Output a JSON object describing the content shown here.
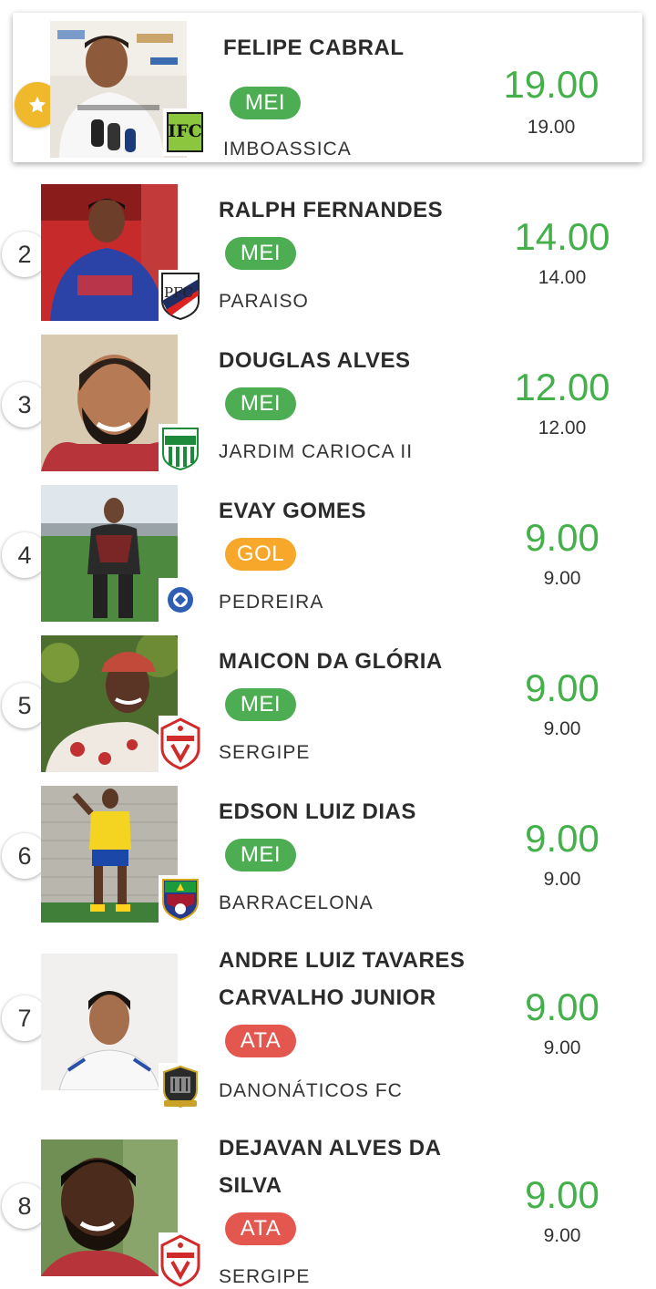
{
  "colors": {
    "score_green": "#43b04a",
    "badge_mei": "#4cad52",
    "badge_gol": "#f7a82a",
    "badge_ata": "#e4574f",
    "star_badge": "#f0b92b"
  },
  "players": [
    {
      "rank": "★",
      "name": [
        "FELIPE CABRAL"
      ],
      "position": "MEI",
      "team": "IMBOASSICA",
      "score": "19.00",
      "sub_score": "19.00",
      "crest_icon": "imboassica-crest-icon"
    },
    {
      "rank": "2",
      "name": [
        "RALPH FERNANDES"
      ],
      "position": "MEI",
      "team": "PARAISO",
      "score": "14.00",
      "sub_score": "14.00",
      "crest_icon": "paraiso-crest-icon"
    },
    {
      "rank": "3",
      "name": [
        "DOUGLAS ALVES"
      ],
      "position": "MEI",
      "team": "JARDIM CARIOCA II",
      "score": "12.00",
      "sub_score": "12.00",
      "crest_icon": "jardim-carioca-crest-icon"
    },
    {
      "rank": "4",
      "name": [
        "EVAY GOMES"
      ],
      "position": "GOL",
      "team": "PEDREIRA",
      "score": "9.00",
      "sub_score": "9.00",
      "crest_icon": "pedreira-crest-icon"
    },
    {
      "rank": "5",
      "name": [
        "MAICON DA GLÓRIA"
      ],
      "position": "MEI",
      "team": "SERGIPE",
      "score": "9.00",
      "sub_score": "9.00",
      "crest_icon": "sergipe-crest-icon"
    },
    {
      "rank": "6",
      "name": [
        "EDSON LUIZ DIAS"
      ],
      "position": "MEI",
      "team": "BARRACELONA",
      "score": "9.00",
      "sub_score": "9.00",
      "crest_icon": "barracelona-crest-icon"
    },
    {
      "rank": "7",
      "name": [
        "ANDRE LUIZ TAVARES",
        "CARVALHO JUNIOR"
      ],
      "position": "ATA",
      "team": "DANONÁTICOS FC",
      "score": "9.00",
      "sub_score": "9.00",
      "crest_icon": "danonaticos-crest-icon"
    },
    {
      "rank": "8",
      "name": [
        "DEJAVAN ALVES DA",
        "SILVA"
      ],
      "position": "ATA",
      "team": "SERGIPE",
      "score": "9.00",
      "sub_score": "9.00",
      "crest_icon": "sergipe-crest-icon"
    }
  ],
  "crest_text": {
    "imboassica": "IFC",
    "paraiso": "PFC"
  }
}
